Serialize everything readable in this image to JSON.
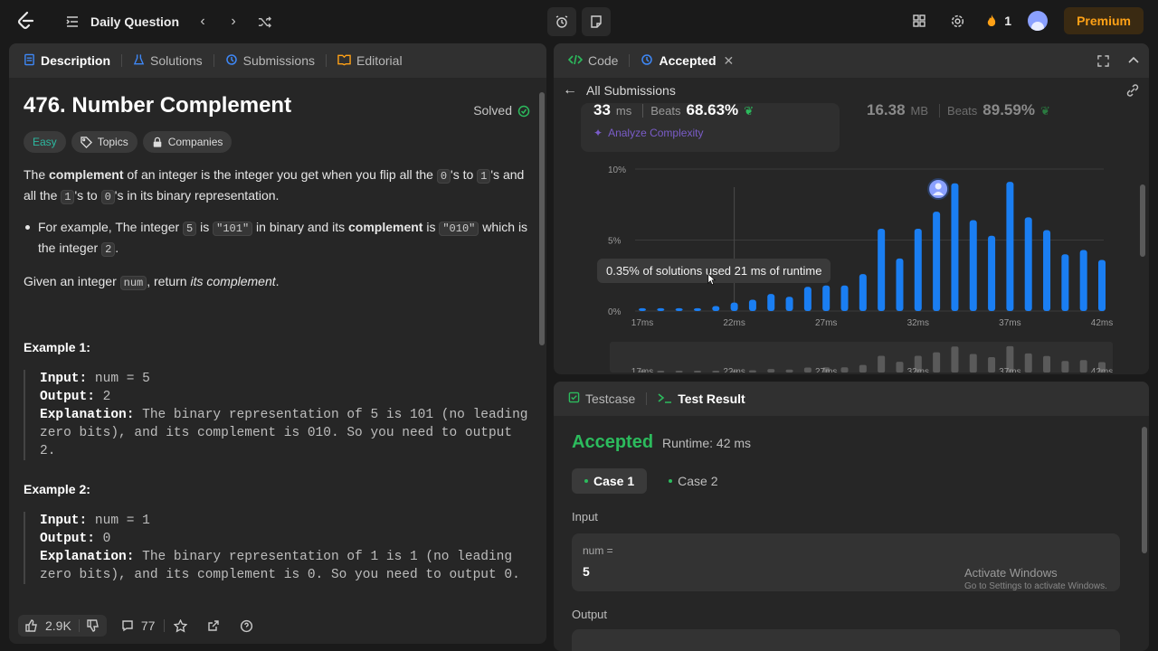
{
  "topbar": {
    "daily_question": "Daily Question",
    "streak_count": "1",
    "premium_label": "Premium"
  },
  "left_tabs": {
    "description": "Description",
    "solutions": "Solutions",
    "submissions": "Submissions",
    "editorial": "Editorial"
  },
  "problem": {
    "title": "476. Number Complement",
    "status": "Solved",
    "difficulty": "Easy",
    "topics_label": "Topics",
    "companies_label": "Companies",
    "p1_a": "The ",
    "p1_bold": "complement",
    "p1_b": " of an integer is the integer you get when you flip all the ",
    "p1_code0": "0",
    "p1_c": "'s to ",
    "p1_code1": "1",
    "p1_d": "'s and all the ",
    "p1_code2": "1",
    "p1_e": "'s to ",
    "p1_code3": "0",
    "p1_f": "'s in its binary representation.",
    "b_a": "For example, The integer ",
    "b_code5": "5",
    "b_b": " is ",
    "b_code101": "\"101\"",
    "b_c": " in binary and its ",
    "b_bold": "complement",
    "b_d": " is ",
    "b_code010": "\"010\"",
    "b_e": " which is the integer ",
    "b_code2": "2",
    "b_f": ".",
    "p2_a": "Given an integer ",
    "p2_code": "num",
    "p2_b": ", return ",
    "p2_em": "its complement",
    "p2_c": ".",
    "examples": [
      {
        "title": "Example 1:",
        "input_label": "Input:",
        "input": " num = 5",
        "output_label": "Output:",
        "output": " 2",
        "explanation_label": "Explanation:",
        "explanation": " The binary representation of 5 is 101 (no leading zero bits), and its complement is 010. So you need to output 2."
      },
      {
        "title": "Example 2:",
        "input_label": "Input:",
        "input": " num = 1",
        "output_label": "Output:",
        "output": " 0",
        "explanation_label": "Explanation:",
        "explanation": " The binary representation of 1 is 1 (no leading zero bits), and its complement is 0. So you need to output 0."
      }
    ]
  },
  "footer": {
    "likes": "2.9K",
    "comments": "77"
  },
  "code_panel": {
    "tab_code": "Code",
    "tab_accepted": "Accepted",
    "all_submissions": "All Submissions",
    "runtime_value": "33",
    "runtime_unit": "ms",
    "beats_label": "Beats",
    "runtime_beats": "68.63%",
    "memory_value": "16.38",
    "memory_unit": "MB",
    "memory_beats": "89.59%",
    "analyze": "Analyze Complexity",
    "tooltip": "0.35% of solutions used 21 ms of runtime"
  },
  "chart_data": {
    "type": "bar",
    "x": [
      17,
      18,
      19,
      20,
      21,
      22,
      23,
      24,
      25,
      26,
      27,
      28,
      29,
      30,
      31,
      32,
      33,
      34,
      35,
      36,
      37,
      38,
      39,
      40,
      41,
      42
    ],
    "values": [
      0.2,
      0.2,
      0.2,
      0.2,
      0.35,
      0.6,
      0.8,
      1.2,
      1.0,
      1.7,
      1.8,
      1.8,
      2.6,
      5.8,
      3.7,
      5.8,
      7.0,
      9.0,
      6.4,
      5.3,
      9.1,
      6.6,
      5.7,
      4.0,
      4.3,
      3.6
    ],
    "ylim": [
      0,
      10
    ],
    "y_ticks": [
      "0%",
      "5%",
      "10%"
    ],
    "x_ticks": [
      "17ms",
      "22ms",
      "27ms",
      "32ms",
      "37ms",
      "42ms"
    ],
    "highlight_x": 33,
    "bar_color": "#1a7ef2"
  },
  "test_panel": {
    "tab_testcase": "Testcase",
    "tab_result": "Test Result",
    "status": "Accepted",
    "runtime": "Runtime: 42 ms",
    "case1": "Case 1",
    "case2": "Case 2",
    "input_label": "Input",
    "input_key": "num =",
    "input_value": "5",
    "output_label": "Output",
    "watermark_title": "Activate Windows",
    "watermark_sub": "Go to Settings to activate Windows."
  }
}
